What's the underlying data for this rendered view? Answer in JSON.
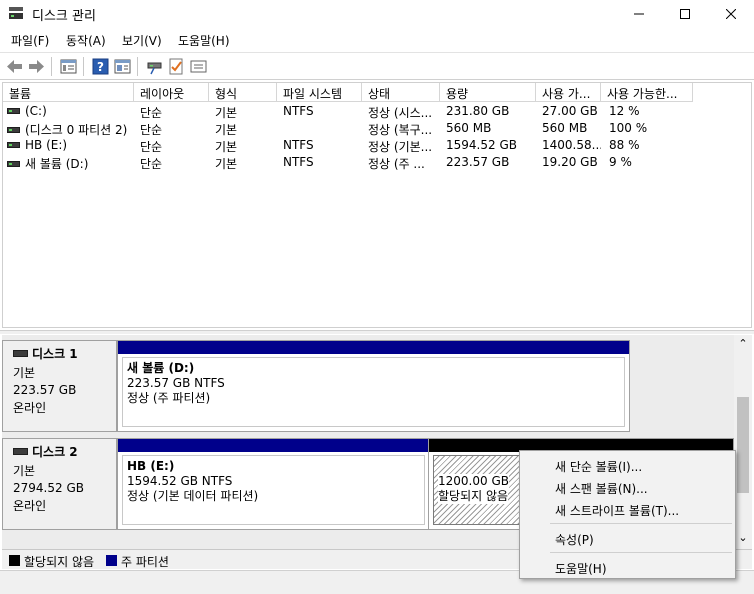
{
  "window": {
    "title": "디스크 관리",
    "minimize_glyph": "—",
    "maximize_glyph": "☐",
    "close_glyph": "✕"
  },
  "menubar": {
    "items": [
      "파일(F)",
      "동작(A)",
      "보기(V)",
      "도움말(H)"
    ]
  },
  "toolbar": {
    "icons": [
      "back-arrow-icon",
      "forward-arrow-icon",
      "disk-list-icon",
      "help-icon",
      "console-view-icon",
      "rescan-disks-icon",
      "properties-check-icon",
      "more-actions-icon"
    ]
  },
  "volume_list": {
    "columns": [
      "볼륨",
      "레이아웃",
      "형식",
      "파일 시스템",
      "상태",
      "용량",
      "사용 가...",
      "사용 가능한..."
    ],
    "rows": [
      {
        "volume": "(C:)",
        "layout": "단순",
        "type": "기본",
        "fs": "NTFS",
        "status": "정상 (시스...",
        "capacity": "231.80 GB",
        "free": "27.00 GB",
        "pct": "12 %"
      },
      {
        "volume": "(디스크 0 파티션 2)",
        "layout": "단순",
        "type": "기본",
        "fs": "",
        "status": "정상 (복구...",
        "capacity": "560 MB",
        "free": "560 MB",
        "pct": "100 %"
      },
      {
        "volume": "HB (E:)",
        "layout": "단순",
        "type": "기본",
        "fs": "NTFS",
        "status": "정상 (기본...",
        "capacity": "1594.52 GB",
        "free": "1400.58...",
        "pct": "88 %"
      },
      {
        "volume": "새 볼륨 (D:)",
        "layout": "단순",
        "type": "기본",
        "fs": "NTFS",
        "status": "정상 (주 ...",
        "capacity": "223.57 GB",
        "free": "19.20 GB",
        "pct": "9 %"
      }
    ]
  },
  "disks": [
    {
      "name": "디스크 1",
      "kind": "기본",
      "size": "223.57 GB",
      "state": "온라인",
      "partitions": [
        {
          "title": "새 볼륨  (D:)",
          "line2": "223.57 GB NTFS",
          "line3": "정상 (주 파티션)"
        }
      ]
    },
    {
      "name": "디스크 2",
      "kind": "기본",
      "size": "2794.52 GB",
      "state": "온라인",
      "partitions": [
        {
          "title": "HB  (E:)",
          "line2": "1594.52 GB NTFS",
          "line3": "정상 (기본 데이터 파티션)"
        },
        {
          "title": "",
          "line2": "1200.00 GB",
          "line3": "할당되지 않음"
        }
      ]
    }
  ],
  "legend": {
    "unallocated": "할당되지 않음",
    "primary": "주 파티션"
  },
  "colors": {
    "primary_partition": "#00008b",
    "unallocated": "#000000"
  },
  "context_menu": {
    "items": [
      "새 단순 볼륨(I)...",
      "새 스팬 볼륨(N)...",
      "새 스트라이프 볼륨(T)...",
      "속성(P)",
      "도움말(H)"
    ]
  },
  "scrollbar": {
    "up_glyph": "⌃",
    "down_glyph": "⌄"
  }
}
